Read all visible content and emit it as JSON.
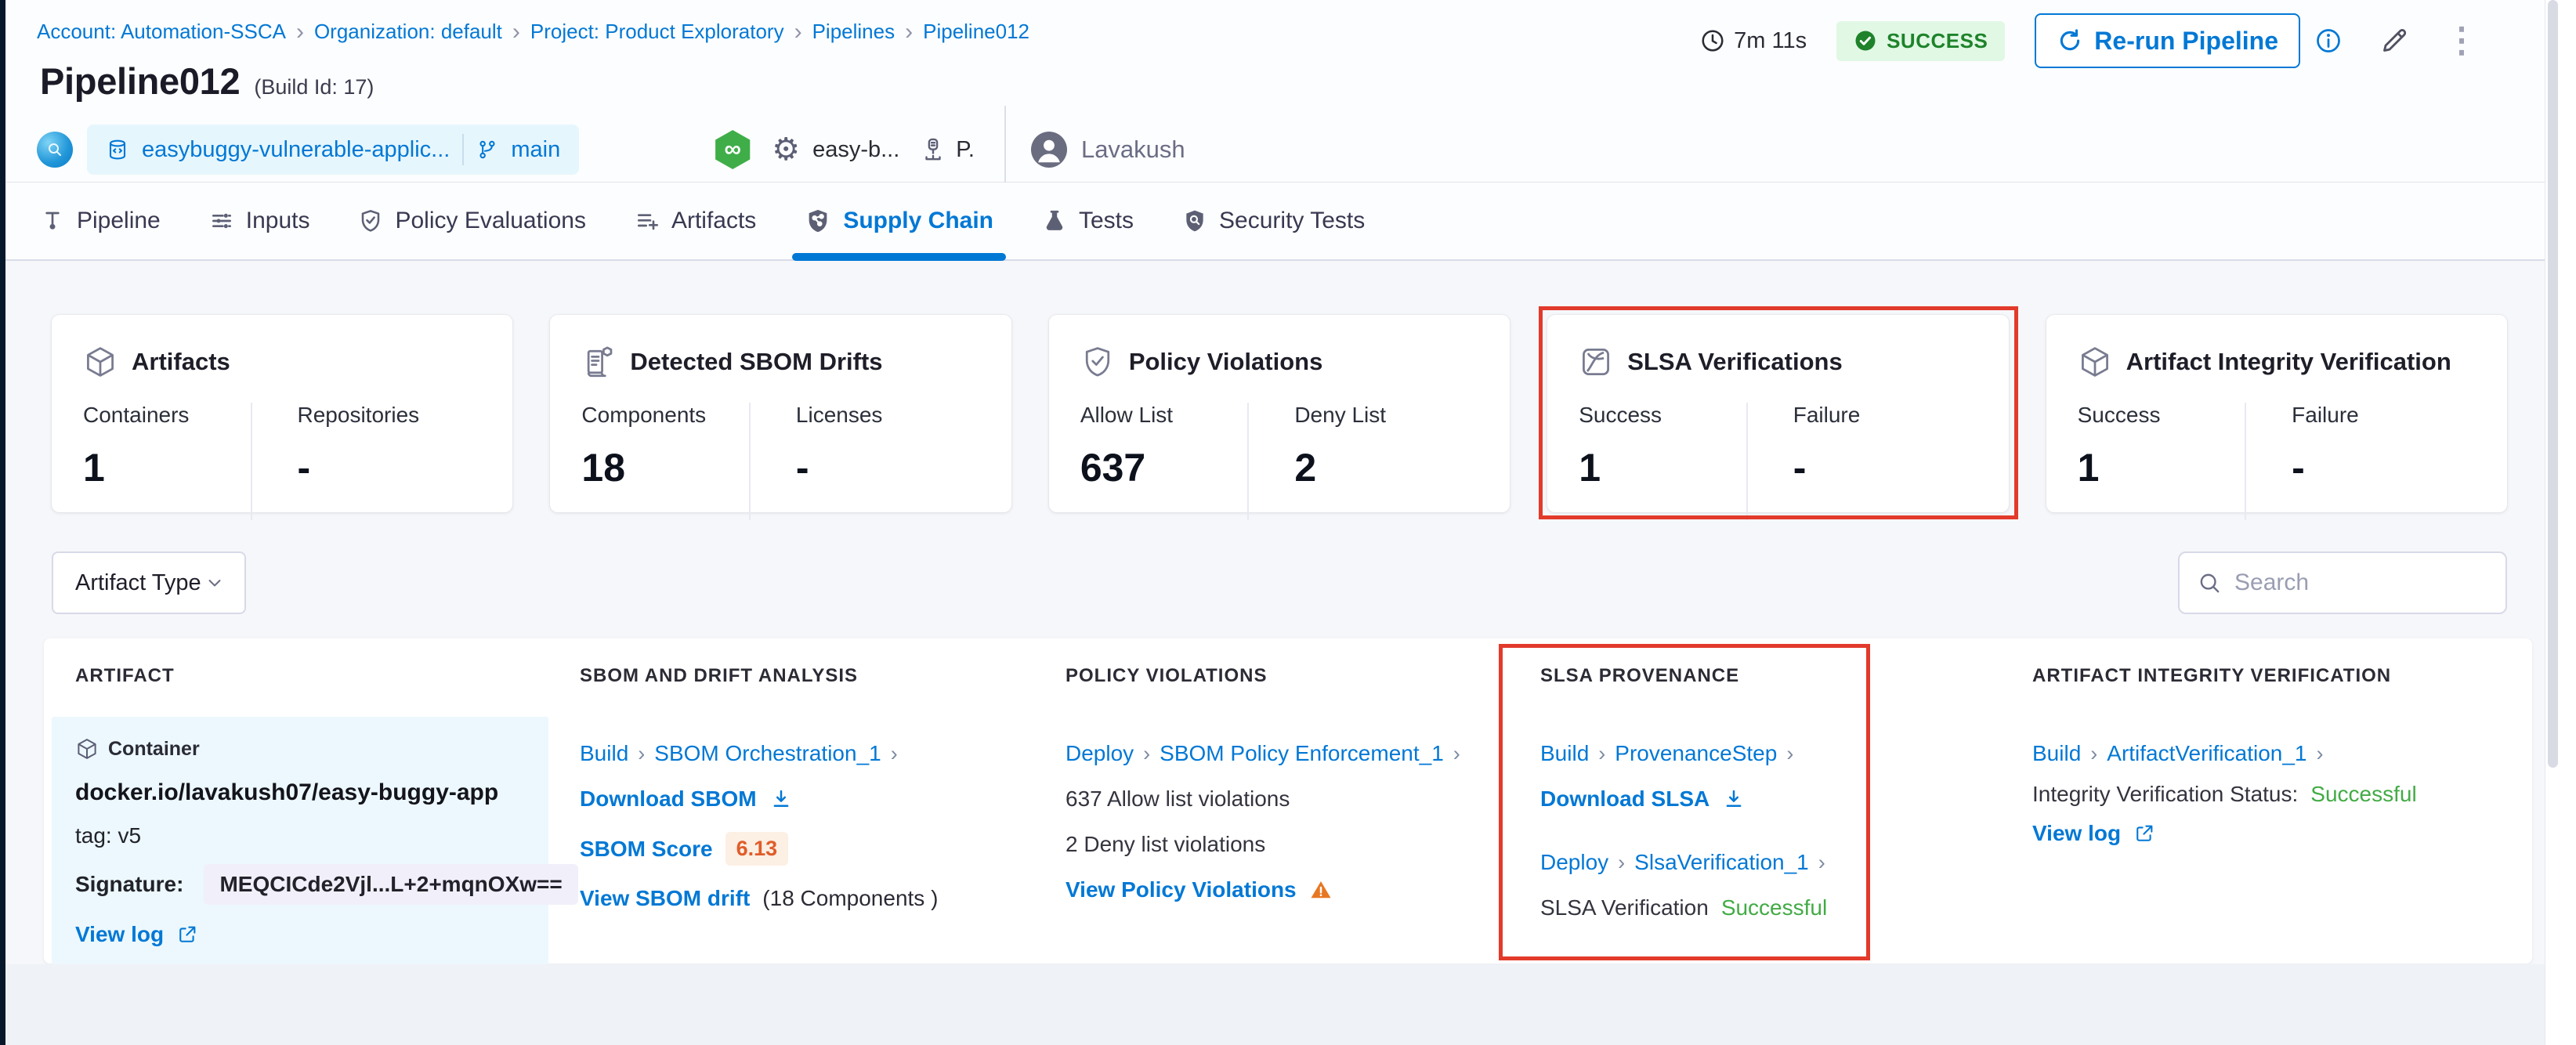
{
  "breadcrumb": {
    "items": [
      "Account: Automation-SSCA",
      "Organization: default",
      "Project: Product Exploratory",
      "Pipelines",
      "Pipeline012"
    ]
  },
  "header": {
    "duration": "7m 11s",
    "status": "SUCCESS",
    "rerun_label": "Re-run Pipeline",
    "title": "Pipeline012",
    "build_id": "(Build Id: 17)",
    "repo_name": "easybuggy-vulnerable-applic...",
    "branch": "main",
    "trigger_text": "easy-b...",
    "trigger_short": "P.",
    "user_name": "Lavakush"
  },
  "tabs": [
    {
      "label": "Pipeline",
      "active": false
    },
    {
      "label": "Inputs",
      "active": false
    },
    {
      "label": "Policy Evaluations",
      "active": false
    },
    {
      "label": "Artifacts",
      "active": false
    },
    {
      "label": "Supply Chain",
      "active": true
    },
    {
      "label": "Tests",
      "active": false
    },
    {
      "label": "Security Tests",
      "active": false
    }
  ],
  "cards": [
    {
      "title": "Artifacts",
      "metrics": [
        {
          "label": "Containers",
          "value": "1"
        },
        {
          "label": "Repositories",
          "value": "-"
        }
      ]
    },
    {
      "title": "Detected SBOM Drifts",
      "metrics": [
        {
          "label": "Components",
          "value": "18"
        },
        {
          "label": "Licenses",
          "value": "-"
        }
      ]
    },
    {
      "title": "Policy Violations",
      "metrics": [
        {
          "label": "Allow List",
          "value": "637"
        },
        {
          "label": "Deny List",
          "value": "2"
        }
      ]
    },
    {
      "title": "SLSA Verifications",
      "highlighted": true,
      "metrics": [
        {
          "label": "Success",
          "value": "1"
        },
        {
          "label": "Failure",
          "value": "-"
        }
      ]
    },
    {
      "title": "Artifact Integrity Verification",
      "metrics": [
        {
          "label": "Success",
          "value": "1"
        },
        {
          "label": "Failure",
          "value": "-"
        }
      ]
    }
  ],
  "filters": {
    "artifact_type_label": "Artifact Type",
    "search_placeholder": "Search"
  },
  "table": {
    "headers": [
      "Artifact",
      "SBOM and Drift Analysis",
      "Policy Violations",
      "SLSA Provenance",
      "Artifact Integrity Verification"
    ],
    "row": {
      "artifact": {
        "type_label": "Container",
        "name": "docker.io/lavakush07/easy-buggy-app",
        "tag": "tag: v5",
        "signature_label": "Signature:",
        "signature_value": "MEQCICde2Vjl...L+2+mqnOXw==",
        "view_log_label": "View log"
      },
      "sbom": {
        "stage": "Build",
        "step": "SBOM Orchestration_1",
        "download_label": "Download SBOM",
        "score_label": "SBOM Score",
        "score_value": "6.13",
        "drift_label": "View SBOM drift",
        "drift_count": "(18 Components )"
      },
      "policy": {
        "stage": "Deploy",
        "step": "SBOM Policy Enforcement_1",
        "allow_text": "637 Allow list violations",
        "deny_text": "2 Deny list violations",
        "view_label": "View Policy Violations"
      },
      "slsa": {
        "stage1": "Build",
        "step1": "ProvenanceStep",
        "download_label": "Download SLSA",
        "stage2": "Deploy",
        "step2": "SlsaVerification_1",
        "status_label": "SLSA Verification",
        "status_value": "Successful"
      },
      "integrity": {
        "stage": "Build",
        "step": "ArtifactVerification_1",
        "status_label": "Integrity Verification Status:",
        "status_value": "Successful",
        "view_log_label": "View log"
      }
    }
  },
  "icons": {
    "chevron": "›",
    "gear": "⚙",
    "infinity": "∞",
    "kebab": "⋮"
  },
  "colors": {
    "accent_blue": "#0278d5",
    "success_green": "#42ab45",
    "highlight_red": "#e23a2b",
    "warning_orange": "#e87722",
    "status_badge_bg": "#e1f8e5",
    "status_badge_text": "#1e832a"
  }
}
